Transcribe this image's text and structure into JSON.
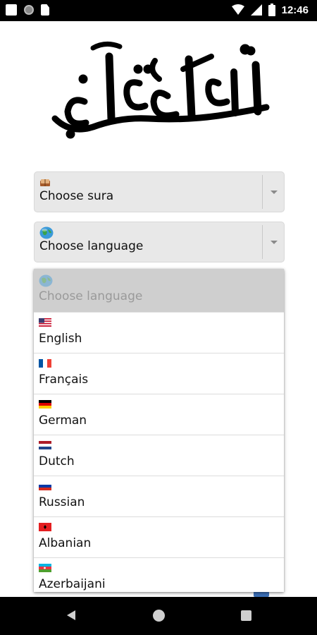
{
  "status_bar": {
    "time": "12:46",
    "icons": [
      "notification-square-icon",
      "record-icon",
      "sd-card-icon",
      "wifi-icon",
      "signal-icon",
      "battery-icon"
    ]
  },
  "logo": {
    "text": "أذكار وقرآن"
  },
  "sura_select": {
    "icon": "quran-book-icon",
    "label": "Choose sura"
  },
  "language_select": {
    "icon": "globe-icon",
    "label": "Choose language"
  },
  "language_dropdown": {
    "placeholder": {
      "icon": "globe-icon",
      "label": "Choose language"
    },
    "options": [
      {
        "label": "English",
        "flag": "us-flag-icon"
      },
      {
        "label": "Français",
        "flag": "fr-flag-icon"
      },
      {
        "label": "German",
        "flag": "de-flag-icon"
      },
      {
        "label": "Dutch",
        "flag": "nl-flag-icon"
      },
      {
        "label": "Russian",
        "flag": "ru-flag-icon"
      },
      {
        "label": "Albanian",
        "flag": "al-flag-icon"
      },
      {
        "label": "Azerbaijani",
        "flag": "az-flag-icon"
      }
    ]
  },
  "nav_bar": {
    "icons": [
      "back-icon",
      "home-icon",
      "recents-icon"
    ]
  }
}
